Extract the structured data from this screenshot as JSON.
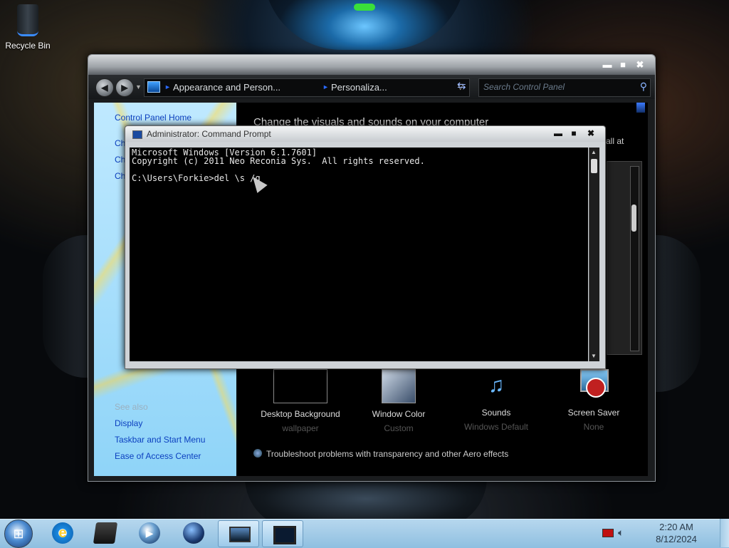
{
  "desktop": {
    "recycle_bin_label": "Recycle Bin"
  },
  "control_panel": {
    "address_crumbs": [
      "Appearance and Person...",
      "Personaliza..."
    ],
    "search_placeholder": "Search Control Panel",
    "left_links": [
      "Control Panel Home",
      "Ch",
      "Ch",
      "Ch"
    ],
    "see_also_label": "See also",
    "see_also_links": [
      "Display",
      "Taskbar and Start Menu",
      "Ease of Access Center"
    ],
    "heading": "Change the visuals and sounds on your computer",
    "side_text": "all at",
    "tiles": [
      {
        "label": "Desktop Background",
        "sub": "wallpaper",
        "icon": "desktop-background-icon"
      },
      {
        "label": "Window Color",
        "sub": "Custom",
        "icon": "window-color-icon"
      },
      {
        "label": "Sounds",
        "sub": "Windows Default",
        "icon": "sounds-icon"
      },
      {
        "label": "Screen Saver",
        "sub": "None",
        "icon": "screen-saver-icon"
      }
    ],
    "troubleshoot_link": "Troubleshoot problems with transparency and other Aero effects",
    "controls": {
      "minimize": "▬",
      "maximize": "■",
      "close": "✖"
    }
  },
  "cmd": {
    "title": "Administrator: Command Prompt",
    "lines": [
      "Microsoft Windows [Version 6.1.7601]",
      "Copyright (c) 2011 Neo Reconia Sys.  All rights reserved.",
      "",
      "C:\\Users\\Forkie>del \\s /q"
    ],
    "controls": {
      "minimize": "▬",
      "maximize": "■",
      "close": "✖"
    }
  },
  "taskbar": {
    "start_glyph": "⊞",
    "apps": [
      "start-button",
      "internet-explorer",
      "file-explorer",
      "media-player",
      "globe-app",
      "control-panel",
      "command-prompt"
    ],
    "time": "2:20 AM",
    "date": "8/12/2024"
  },
  "colors": {
    "link_blue": "#0b3fbf",
    "taskbar_blue": "#a8cfea",
    "cmd_bg": "#000000"
  }
}
